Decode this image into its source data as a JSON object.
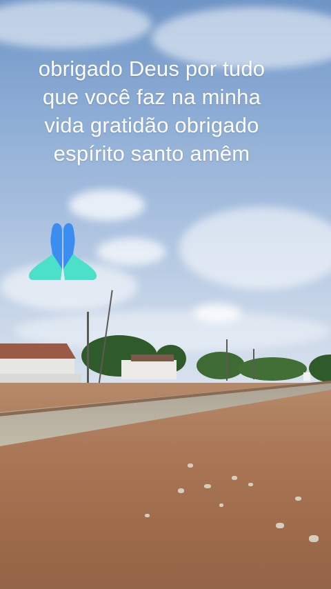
{
  "caption": {
    "lines": [
      "obrigado Deus por tudo",
      "que você faz na minha",
      "vida gratidão obrigado",
      "espírito santo amêm"
    ]
  },
  "emoji": {
    "name": "praying-hands-icon",
    "colors": {
      "hand": "#3b8df0",
      "sleeve": "#4de0c8"
    }
  },
  "scene": {
    "description_tags": [
      "sky",
      "clouds",
      "dirt-road",
      "houses",
      "trees",
      "power-poles"
    ]
  }
}
